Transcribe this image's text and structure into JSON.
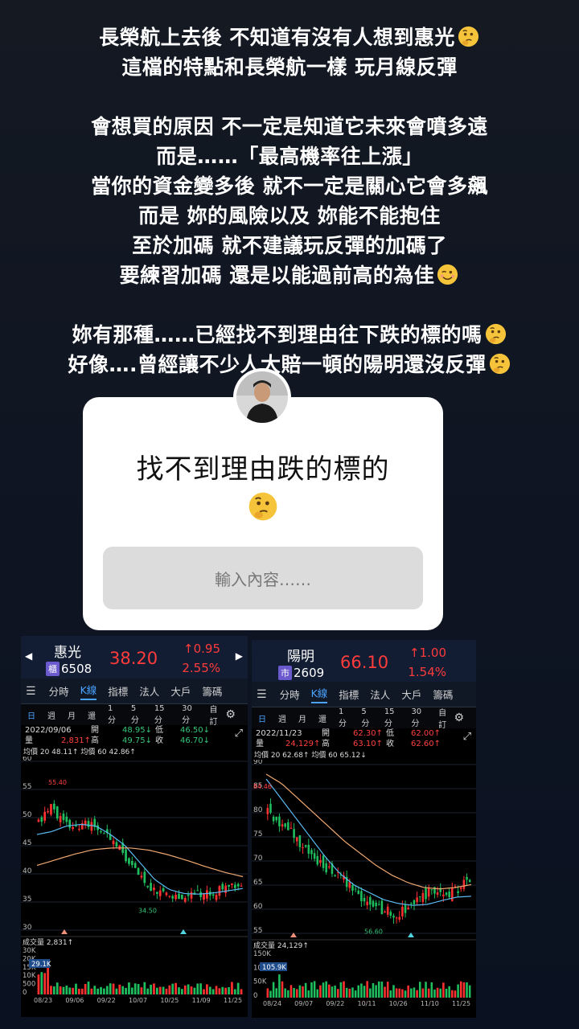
{
  "story": {
    "lines": [
      "長榮航上去後 不知道有沒有人想到惠光",
      "這檔的特點和長榮航一樣 玩月線反彈",
      "",
      "會想買的原因 不一定是知道它未來會噴多遠",
      "而是……「最高機率往上漲」",
      "當你的資金變多後 就不一定是關心它會多飆",
      "而是 妳的風險以及 妳能不能抱住",
      "至於加碼 就不建議玩反彈的加碼了",
      "要練習加碼 還是以能過前高的為佳",
      "",
      "妳有那種……已經找不到理由往下跌的標的嗎",
      "好像….曾經讓不少人大賠一頓的陽明還沒反彈"
    ]
  },
  "question_box": {
    "title": "找不到理由跌的標的",
    "input_placeholder": "輸入內容……"
  },
  "panels": [
    {
      "name": "惠光",
      "market": "櫃",
      "code": "6508",
      "price": "38.20",
      "change": "0.95",
      "change_pct": "2.55%",
      "date": "2022/09/06",
      "open": "48.95",
      "high": "49.75",
      "low": "46.50",
      "close": "46.70",
      "volume": "2,831",
      "ma_text": "均價 20 48.11↑ 均價 60 42.86↑",
      "volume_label": "成交量 2,831↑",
      "vol_max_label": "29.1K",
      "tick_high": "55.40",
      "tick_low": "34.50",
      "y_ticks": [
        "60",
        "55",
        "50",
        "45",
        "40",
        "35",
        "30"
      ],
      "vol_ticks": [
        "30K",
        "20K",
        "15K",
        "10K",
        "500",
        "0"
      ],
      "x_ticks": [
        "08/23",
        "09/06",
        "09/22",
        "10/07",
        "10/25",
        "11/09",
        "11/25"
      ]
    },
    {
      "name": "陽明",
      "market": "市",
      "code": "2609",
      "price": "66.10",
      "change": "1.00",
      "change_pct": "1.54%",
      "date": "2022/11/23",
      "open": "62.30",
      "high": "63.10",
      "low": "62.00",
      "close": "62.60",
      "volume": "24,129",
      "ma_text": "均價 20 62.68↑ 均價 60 65.12↓",
      "volume_label": "成交量 24,129↑",
      "vol_max_label": "105.9K",
      "tick_high": "84.46",
      "tick_low": "56.60",
      "y_ticks": [
        "90",
        "85",
        "80",
        "75",
        "70",
        "65",
        "60",
        "55"
      ],
      "vol_ticks": [
        "150K",
        "100K",
        "50K",
        "0"
      ],
      "x_ticks": [
        "08/24",
        "09/07",
        "09/22",
        "10/11",
        "10/26",
        "11/10",
        "11/25"
      ]
    }
  ],
  "tabs": [
    "分時",
    "K線",
    "指標",
    "法人",
    "大戶",
    "籌碼"
  ],
  "periods": [
    "日",
    "週",
    "月",
    "還",
    "1分",
    "5分",
    "15分",
    "30分",
    "自訂"
  ],
  "ohlc_labels": {
    "open": "開",
    "high": "高",
    "low": "低",
    "close": "收",
    "volume": "量"
  },
  "colors": {
    "up": "#ff3b3b",
    "down": "#36c67a",
    "accent": "#4aa3ff",
    "ma20": "#5ab8f0",
    "ma60": "#f0a870"
  },
  "icons": [
    "thinking-face-icon",
    "winking-face-icon",
    "gear-icon",
    "fullscreen-icon",
    "menu-icon",
    "arrow-left-icon",
    "arrow-right-icon"
  ]
}
